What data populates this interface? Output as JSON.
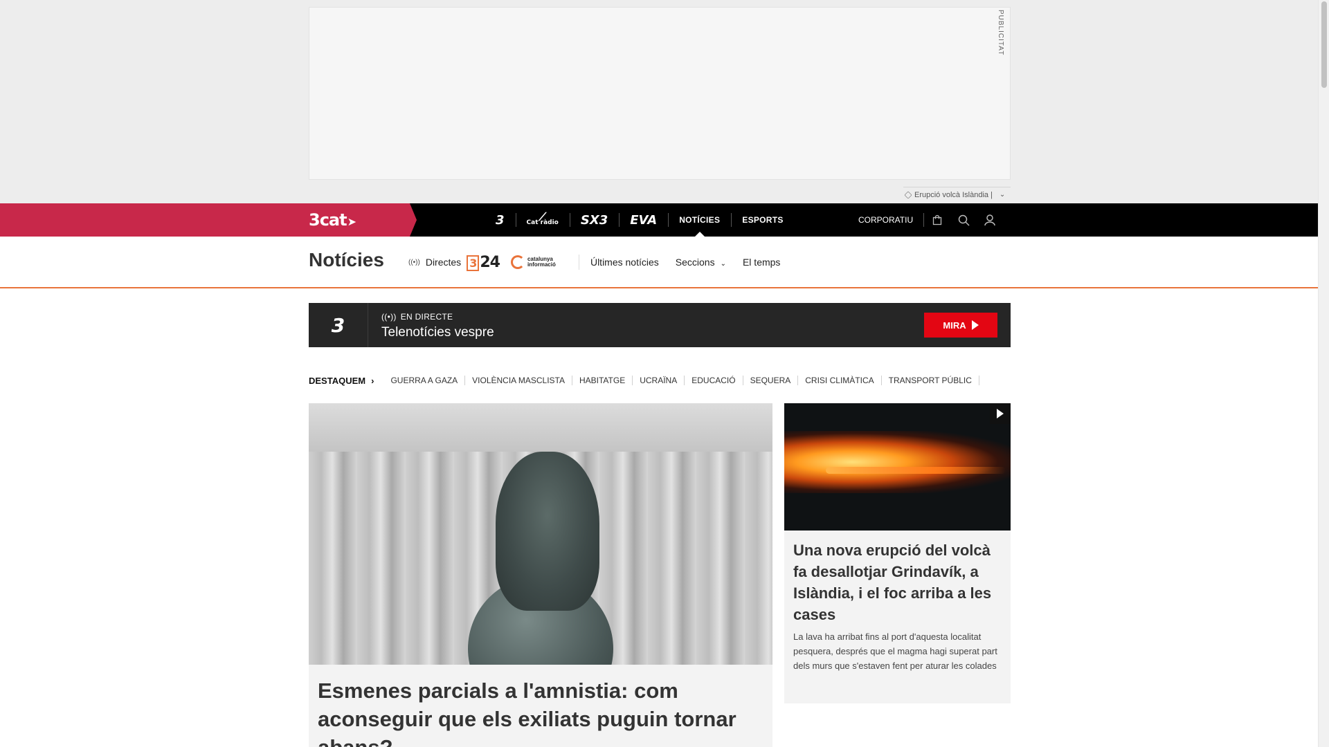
{
  "ad": {
    "label": "PUBLICITAT"
  },
  "tag_bar": {
    "text": "Erupció volcà Islàndia |"
  },
  "topnav": {
    "brand": "3cat",
    "channels": [
      {
        "label": "3",
        "icon": "tv3-logo"
      },
      {
        "label": "Cat ràdio",
        "icon": "catradio-logo"
      },
      {
        "label": "SX3",
        "icon": "sx3-logo"
      },
      {
        "label": "EVA",
        "icon": "eva-logo"
      },
      {
        "label": "NOTÍCIES",
        "active": true
      },
      {
        "label": "ESPORTS"
      }
    ],
    "corporate": "CORPORATIU",
    "icons": [
      "shopping-bag-icon",
      "search-icon",
      "user-icon"
    ]
  },
  "section": {
    "title": "Notícies",
    "directes": "Directes",
    "logo_324": "24",
    "logo_ci": "catalunya informació",
    "links": [
      "Últimes notícies",
      "Seccions",
      "El temps"
    ]
  },
  "live": {
    "channel": "3",
    "status": "EN DIRECTE",
    "title": "Telenotícies vespre",
    "button": "MIRA"
  },
  "destaquem": {
    "label": "DESTAQUEM",
    "items": [
      "GUERRA A GAZA",
      "VIOLÈNCIA MASCLISTA",
      "HABITATGE",
      "UCRAÏNA",
      "EDUCACIÓ",
      "SEQUERA",
      "CRISI CLIMÀTICA",
      "TRANSPORT PÚBLIC"
    ]
  },
  "main_article": {
    "title": "Esmenes parcials a l'amnistia: com aconseguir que els exiliats puguin tornar abans?"
  },
  "side_article": {
    "title": "Una nova erupció del volcà fa desallotjar Grindavík, a Islàndia, i el foc arriba a les cases",
    "description": "La lava ha arribat fins al port d'aquesta localitat pesquera, després que el magma hagi superat part dels murs que s'estaven fent per aturar les colades"
  },
  "colors": {
    "brand": "#c8284a",
    "accent": "#e9733a",
    "live_button": "#e30613"
  }
}
